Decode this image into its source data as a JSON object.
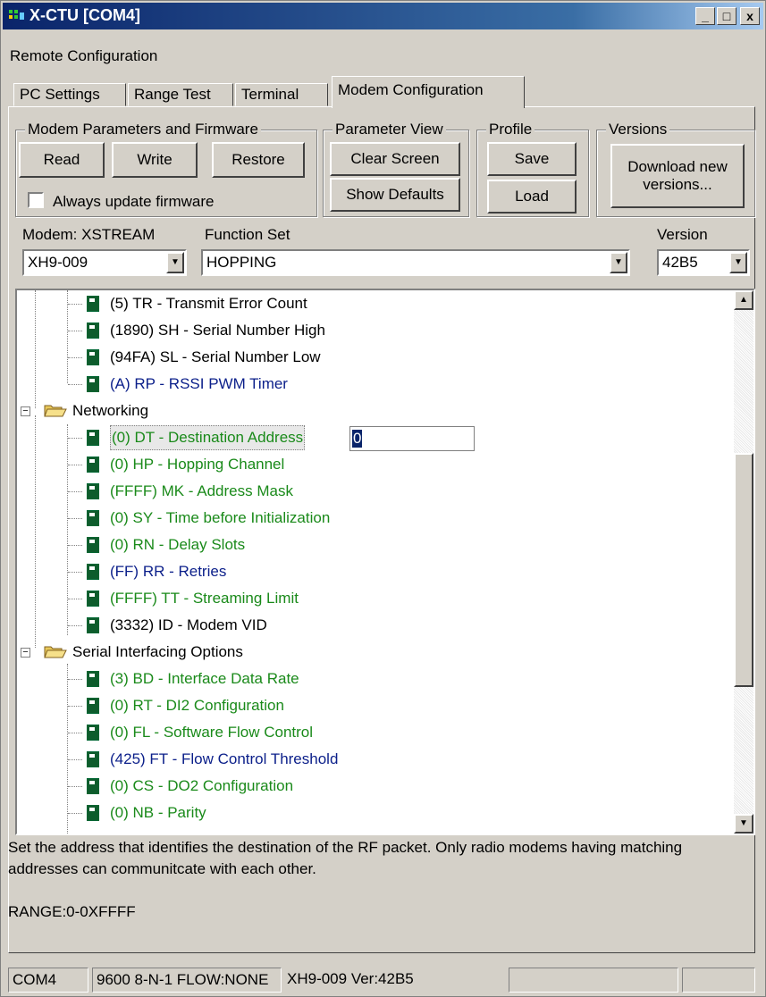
{
  "window": {
    "title": "X-CTU  [COM4]",
    "minimize": "_",
    "maximize": "□",
    "close": "x"
  },
  "menu": {
    "label": "Remote Configuration"
  },
  "tabs": [
    "PC Settings",
    "Range Test",
    "Terminal",
    "Modem Configuration"
  ],
  "active_tab": "Modem Configuration",
  "groups": {
    "modem_params": {
      "title": "Modem Parameters and Firmware",
      "read": "Read",
      "write": "Write",
      "restore": "Restore",
      "always_update": "Always update firmware"
    },
    "parameter_view": {
      "title": "Parameter View",
      "clear": "Clear Screen",
      "defaults": "Show Defaults"
    },
    "profile": {
      "title": "Profile",
      "save": "Save",
      "load": "Load"
    },
    "versions": {
      "title": "Versions",
      "download": "Download new versions..."
    }
  },
  "selectors": {
    "modem_label": "Modem: XSTREAM",
    "modem_value": "XH9-009",
    "function_label": "Function Set",
    "function_value": "HOPPING",
    "version_label": "Version",
    "version_value": "42B5"
  },
  "tree": {
    "top_items": [
      {
        "text": "(5) TR - Transmit Error Count",
        "color": "black"
      },
      {
        "text": "(1890) SH - Serial Number High",
        "color": "black"
      },
      {
        "text": "(94FA) SL - Serial Number Low",
        "color": "black"
      },
      {
        "text": "(A) RP - RSSI PWM Timer",
        "color": "blue"
      }
    ],
    "networking": {
      "label": "Networking",
      "items": [
        {
          "text": "(0) DT - Destination Address",
          "color": "green",
          "selected": true
        },
        {
          "text": "(0) HP - Hopping Channel",
          "color": "green"
        },
        {
          "text": "(FFFF) MK - Address Mask",
          "color": "green"
        },
        {
          "text": "(0) SY - Time before Initialization",
          "color": "green"
        },
        {
          "text": "(0) RN - Delay Slots",
          "color": "green"
        },
        {
          "text": "(FF) RR - Retries",
          "color": "blue"
        },
        {
          "text": "(FFFF) TT - Streaming Limit",
          "color": "green"
        },
        {
          "text": "(3332) ID - Modem VID",
          "color": "black"
        }
      ],
      "edit_value": "0"
    },
    "serial": {
      "label": "Serial Interfacing Options",
      "items": [
        {
          "text": "(3) BD - Interface Data Rate",
          "color": "green"
        },
        {
          "text": "(0) RT - DI2 Configuration",
          "color": "green"
        },
        {
          "text": "(0) FL - Software Flow Control",
          "color": "green"
        },
        {
          "text": "(425) FT - Flow Control Threshold",
          "color": "blue"
        },
        {
          "text": "(0) CS - DO2 Configuration",
          "color": "green"
        },
        {
          "text": "(0) NB - Parity",
          "color": "green"
        }
      ]
    },
    "scroll_position": 0.55
  },
  "description": {
    "text": "Set the address that identifies the destination of the RF packet. Only radio modems having matching addresses can communitcate with each other.",
    "range": "RANGE:0-0XFFFF"
  },
  "status": {
    "port": "COM4",
    "settings": "9600 8-N-1  FLOW:NONE",
    "modem": "XH9-009  Ver:42B5"
  }
}
